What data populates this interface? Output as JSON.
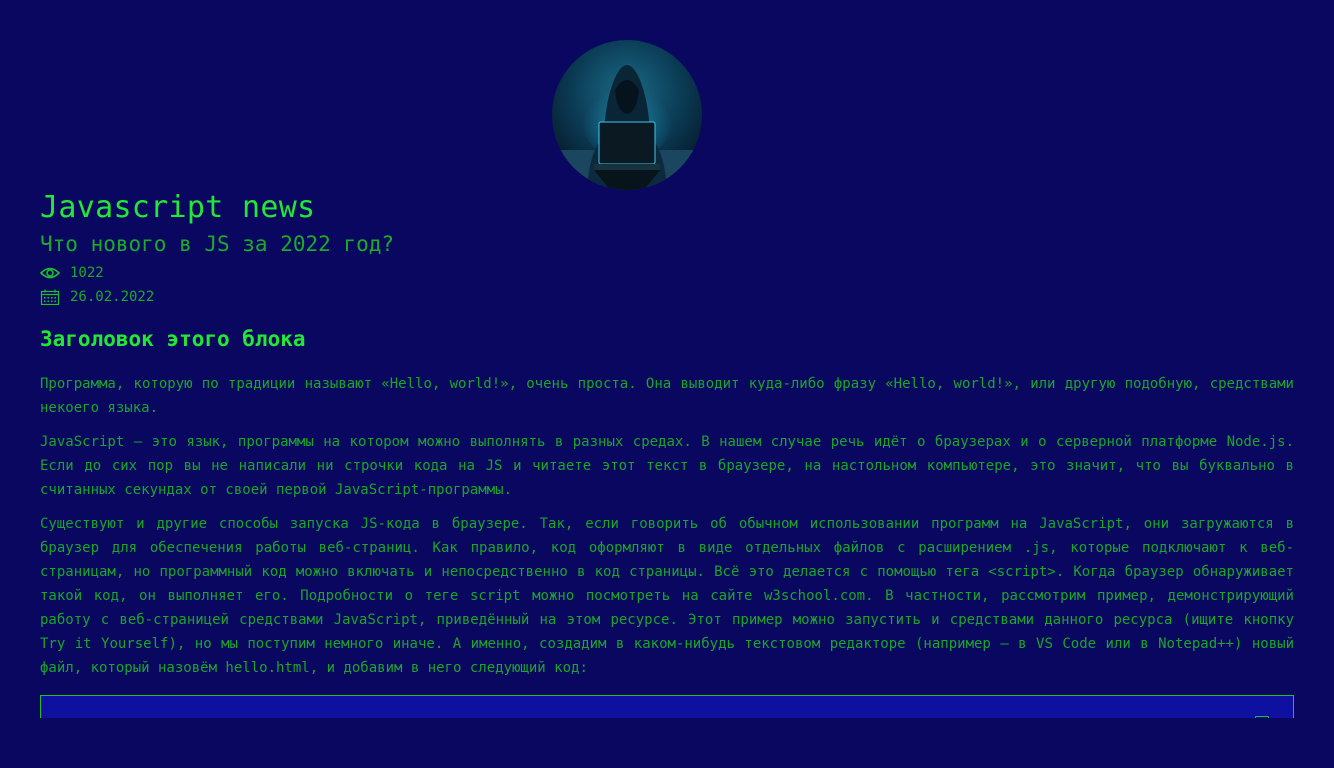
{
  "header": {
    "avatar_icon": "hacker-laptop-avatar",
    "title": "Javascript news",
    "subtitle": "Что нового в JS за 2022 год?"
  },
  "meta": {
    "views_icon": "eye-icon",
    "views": "1022",
    "date_icon": "calendar-icon",
    "date": "26.02.2022"
  },
  "block": {
    "heading": "Заголовок этого блока",
    "paragraphs": [
      "Программа, которую по традиции называют «Hello, world!», очень проста. Она выводит куда-либо фразу «Hello, world!», или другую подобную, средствами некоего языка.",
      "JavaScript — это язык, программы на котором можно выполнять в разных средах. В нашем случае речь идёт о браузерах и о серверной платформе Node.js. Если до сих пор вы не написали ни строчки кода на JS и читаете этот текст в браузере, на настольном компьютере, это значит, что вы буквально в считанных секундах от своей первой JavaScript-программы.",
      "Существуют и другие способы запуска JS-кода в браузере. Так, если говорить об обычном использовании программ на JavaScript, они загружаются в браузер для обеспечения работы веб-страниц. Как правило, код оформляют в виде отдельных файлов с расширением .js, которые подключают к веб-страницам, но программный код можно включать и непосредственно в код страницы. Всё это делается с помощью тега <script>. Когда браузер обнаруживает такой код, он выполняет его. Подробности о теге script можно посмотреть на сайте w3school.com. В частности, рассмотрим пример, демонстрирующий работу с веб-страницей средствами JavaScript, приведённый на этом ресурсе. Этот пример можно запустить и средствами данного ресурса (ищите кнопку Try it Yourself), но мы поступим немного иначе. А именно, создадим в каком-нибудь текстовом редакторе (например — в VS Code или в Notepad++) новый файл, который назовём hello.html, и добавим в него следующий код:"
    ]
  },
  "code_block": {
    "copy_icon": "copy-icon"
  },
  "colors": {
    "background": "#0a0760",
    "accent_green": "#22e835",
    "text_green": "#19a62a",
    "code_background": "#0e11a0"
  }
}
